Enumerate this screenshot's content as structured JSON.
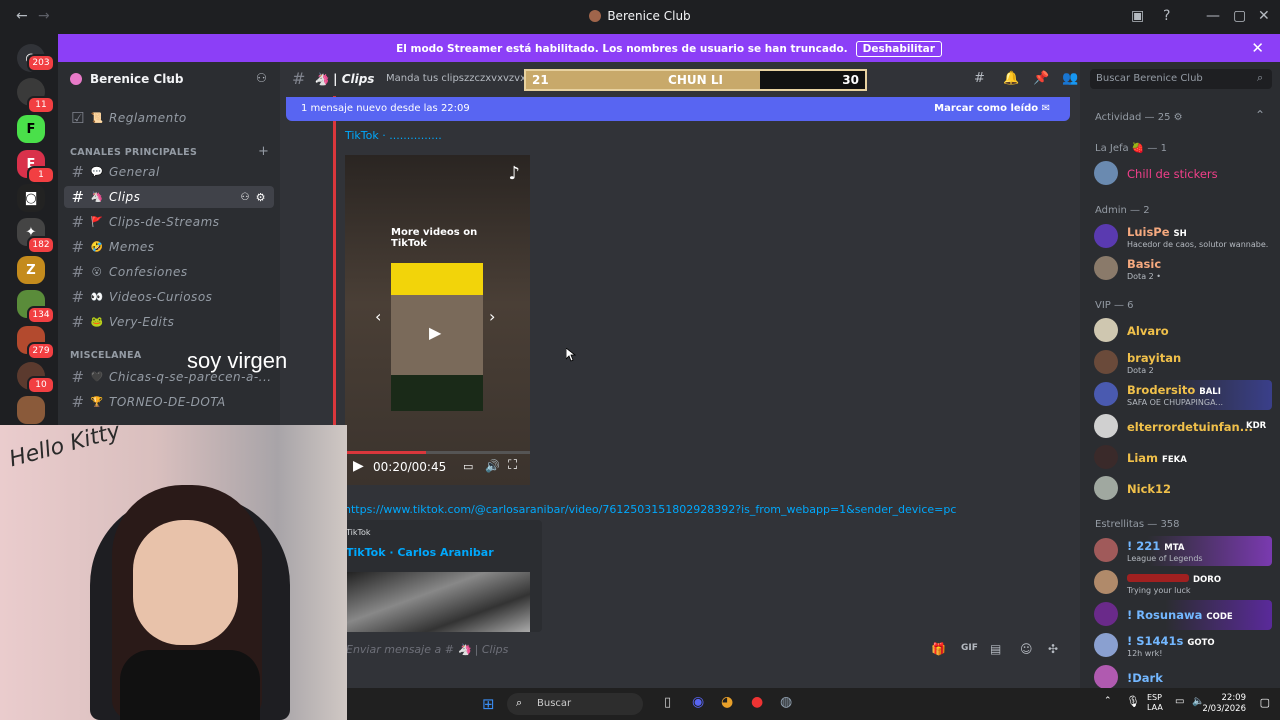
{
  "window": {
    "title": "Berenice Club"
  },
  "banner": {
    "text": "El modo Streamer está habilitado. Los nombres de usuario se han truncado.",
    "button": "Deshabilitar"
  },
  "rail": {
    "badges": [
      "203",
      "11",
      "1",
      "182",
      "134",
      "279",
      "10"
    ]
  },
  "server": {
    "name": "Berenice Club"
  },
  "sidebar": {
    "top_item": "Reglamento",
    "cat_main": "CANALES PRINCIPALES",
    "cat_misc": "MISCELANEA",
    "channels": [
      {
        "emoji": "💬",
        "label": "General"
      },
      {
        "emoji": "🦄",
        "label": "Clips"
      },
      {
        "emoji": "🚩",
        "label": "Clips-de-Streams"
      },
      {
        "emoji": "🤣",
        "label": "Memes"
      },
      {
        "emoji": "😮",
        "label": "Confesiones"
      },
      {
        "emoji": "👀",
        "label": "Videos-Curiosos"
      },
      {
        "emoji": "🐸",
        "label": "Very-Edits"
      },
      {
        "emoji": "🖤",
        "label": "Chicas-q-se-parecen-a-..."
      },
      {
        "emoji": "🏆",
        "label": "TORNEO-DE-DOTA"
      }
    ]
  },
  "chat_header": {
    "channel": "Clips",
    "topic": "Manda tus clipszzczxvxvzvxvz!!"
  },
  "score": {
    "left": "21",
    "center": "CHUN LI",
    "right": "30",
    "fill_fraction": 0.69
  },
  "new_messages": {
    "text": "1 mensaje nuevo desde las 22:09",
    "action": "Marcar como leído"
  },
  "embed1": {
    "title": "TikTok · ...............",
    "overlay_title": "More videos on TikTok",
    "time": "00:20/00:45"
  },
  "url": "https://www.tiktok.com/@carlosaranibar/video/7612503151802928392?is_from_webapp=1&sender_device=pc",
  "embed2": {
    "provider": "TikTok",
    "title": "TikTok · Carlos Aranibar"
  },
  "input": {
    "placeholder": "Enviar mensaje a # 🦄 | Clips"
  },
  "members": {
    "search_placeholder": "Buscar Berenice Club",
    "activity": "Actividad — 25",
    "sections": {
      "jefa": "La Jefa 🍓 — 1",
      "admin": "Admin — 2",
      "vip": "VIP — 6",
      "estrellitas": "Estrellitas — 358"
    },
    "list": [
      {
        "name": "Chill de stickers",
        "status": "",
        "tag": "",
        "color": "#f23f8a"
      },
      {
        "name": "LuisPe",
        "status": "Hacedor de caos, solutor wannabe.",
        "tag": "SH",
        "color": "#f5a97f"
      },
      {
        "name": "Basic",
        "status": "Dota 2 •",
        "tag": "",
        "color": "#f5a97f"
      },
      {
        "name": "Alvaro",
        "status": "",
        "tag": "",
        "color": "#f0c04a"
      },
      {
        "name": "brayitan",
        "status": "Dota 2",
        "tag": "",
        "color": "#f0c04a"
      },
      {
        "name": "Brodersito",
        "status": "SAFA OE CHUPAPINGA...",
        "tag": "BALI",
        "color": "#f0c04a"
      },
      {
        "name": "elterrordetuinfan...",
        "status": "",
        "tag": "KDR",
        "color": "#f0c04a"
      },
      {
        "name": "Liam",
        "status": "",
        "tag": "FEKA",
        "color": "#f0c04a"
      },
      {
        "name": "Nick12",
        "status": "",
        "tag": "",
        "color": "#f0c04a"
      },
      {
        "name": "! 221",
        "status": "League of Legends",
        "tag": "MTA",
        "color": "#73b7ff"
      },
      {
        "name": "",
        "status": "Trying your luck",
        "tag": "DORO",
        "color": "#ff3d3d"
      },
      {
        "name": "! Rosunawa",
        "status": "",
        "tag": "CODE",
        "color": "#73b7ff"
      },
      {
        "name": "! S1441s",
        "status": "12h wrk!",
        "tag": "GOTO",
        "color": "#73b7ff"
      },
      {
        "name": "!Dark",
        "status": "",
        "tag": "",
        "color": "#73b7ff"
      }
    ]
  },
  "webcam": {
    "caption": "soy virgen"
  },
  "taskbar": {
    "search": "Buscar",
    "lang": "ESP\nLAA",
    "time": "22:09",
    "date": "2/03/2026"
  }
}
